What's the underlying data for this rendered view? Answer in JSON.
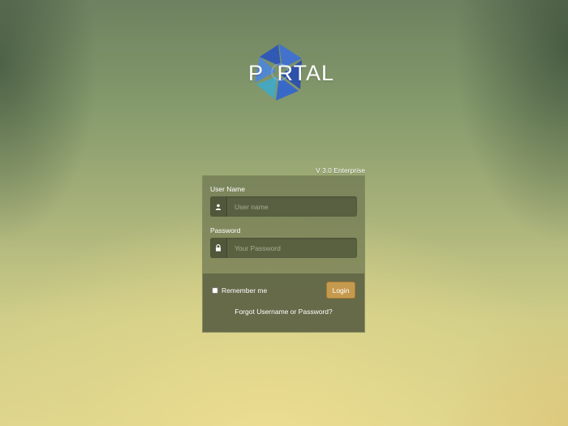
{
  "logo": {
    "text": "P  RTAL",
    "alt": "PORTAL"
  },
  "version": "V 3.0 Enterprise",
  "form": {
    "username": {
      "label": "User Name",
      "placeholder": "User name",
      "value": "",
      "icon": "user-icon"
    },
    "password": {
      "label": "Password",
      "placeholder": "Your Password",
      "value": "",
      "icon": "lock-icon"
    },
    "remember_label": "Remember me",
    "remember_checked": false,
    "login_label": "Login",
    "forgot_link": "Forgot Username or Password?"
  },
  "colors": {
    "login_button": "#c69a4e",
    "logo_blue": "#3c6fd6",
    "logo_teal": "#3fa8c8"
  }
}
